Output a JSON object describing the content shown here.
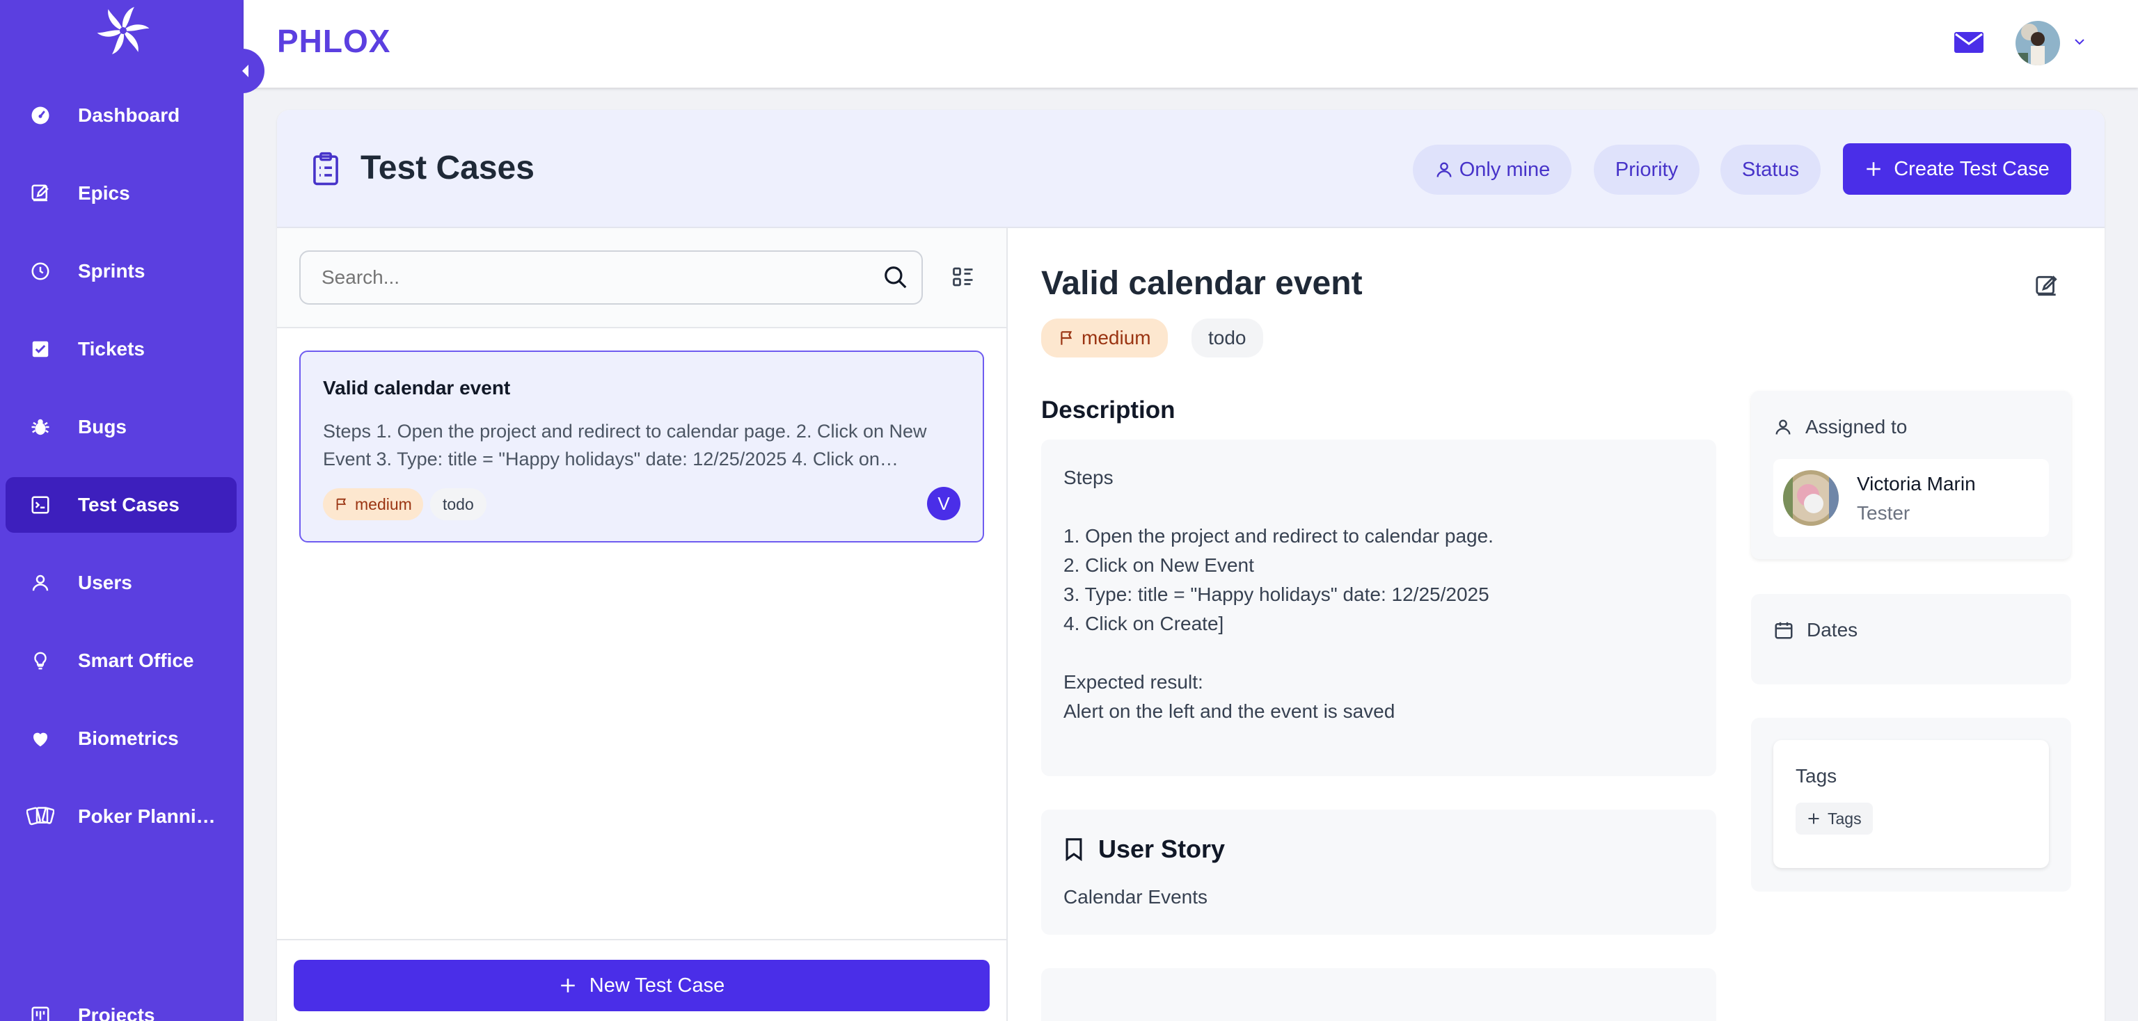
{
  "sidebar": {
    "items": [
      {
        "label": "Dashboard",
        "icon": "dashboard-gauge-icon"
      },
      {
        "label": "Epics",
        "icon": "edit-icon"
      },
      {
        "label": "Sprints",
        "icon": "clock-icon"
      },
      {
        "label": "Tickets",
        "icon": "checkbox-icon"
      },
      {
        "label": "Bugs",
        "icon": "bug-icon"
      },
      {
        "label": "Test Cases",
        "icon": "terminal-icon",
        "active": true
      },
      {
        "label": "Users",
        "icon": "user-icon"
      },
      {
        "label": "Smart Office",
        "icon": "lightbulb-icon"
      },
      {
        "label": "Biometrics",
        "icon": "heart-icon"
      },
      {
        "label": "Poker Planning",
        "icon": "cards-icon"
      },
      {
        "label": "Projects",
        "icon": "board-icon"
      }
    ]
  },
  "header": {
    "brand": "PHLOX"
  },
  "page": {
    "title": "Test Cases",
    "filters": {
      "only_mine": "Only mine",
      "priority": "Priority",
      "status": "Status"
    },
    "create_label": "Create Test Case"
  },
  "list": {
    "search_placeholder": "Search...",
    "items": [
      {
        "title": "Valid calendar event",
        "description": "Steps 1. Open the project and redirect to calendar page. 2. Click on New Event 3. Type: title = \"Happy holidays\" date: 12/25/2025 4. Click on…",
        "priority": "medium",
        "status": "todo",
        "avatar_letter": "V"
      }
    ],
    "new_label": "New Test Case"
  },
  "detail": {
    "title": "Valid calendar event",
    "priority": "medium",
    "status": "todo",
    "description_heading": "Description",
    "description": "Steps\n\n1. Open the project and redirect to calendar page.\n2. Click on New Event\n3. Type: title = \"Happy holidays\" date: 12/25/2025\n4. Click on Create]\n\nExpected result:\nAlert on the left and the event is saved",
    "user_story_heading": "User Story",
    "user_story": "Calendar Events",
    "assigned_label": "Assigned to",
    "assignee": {
      "name": "Victoria Marin",
      "role": "Tester"
    },
    "dates_label": "Dates",
    "tags_label": "Tags",
    "tags_add_label": "Tags"
  },
  "colors": {
    "sidebar": "#5b3fe0",
    "primary": "#4a2ee8",
    "medium_badge_bg": "#fde7cf"
  }
}
